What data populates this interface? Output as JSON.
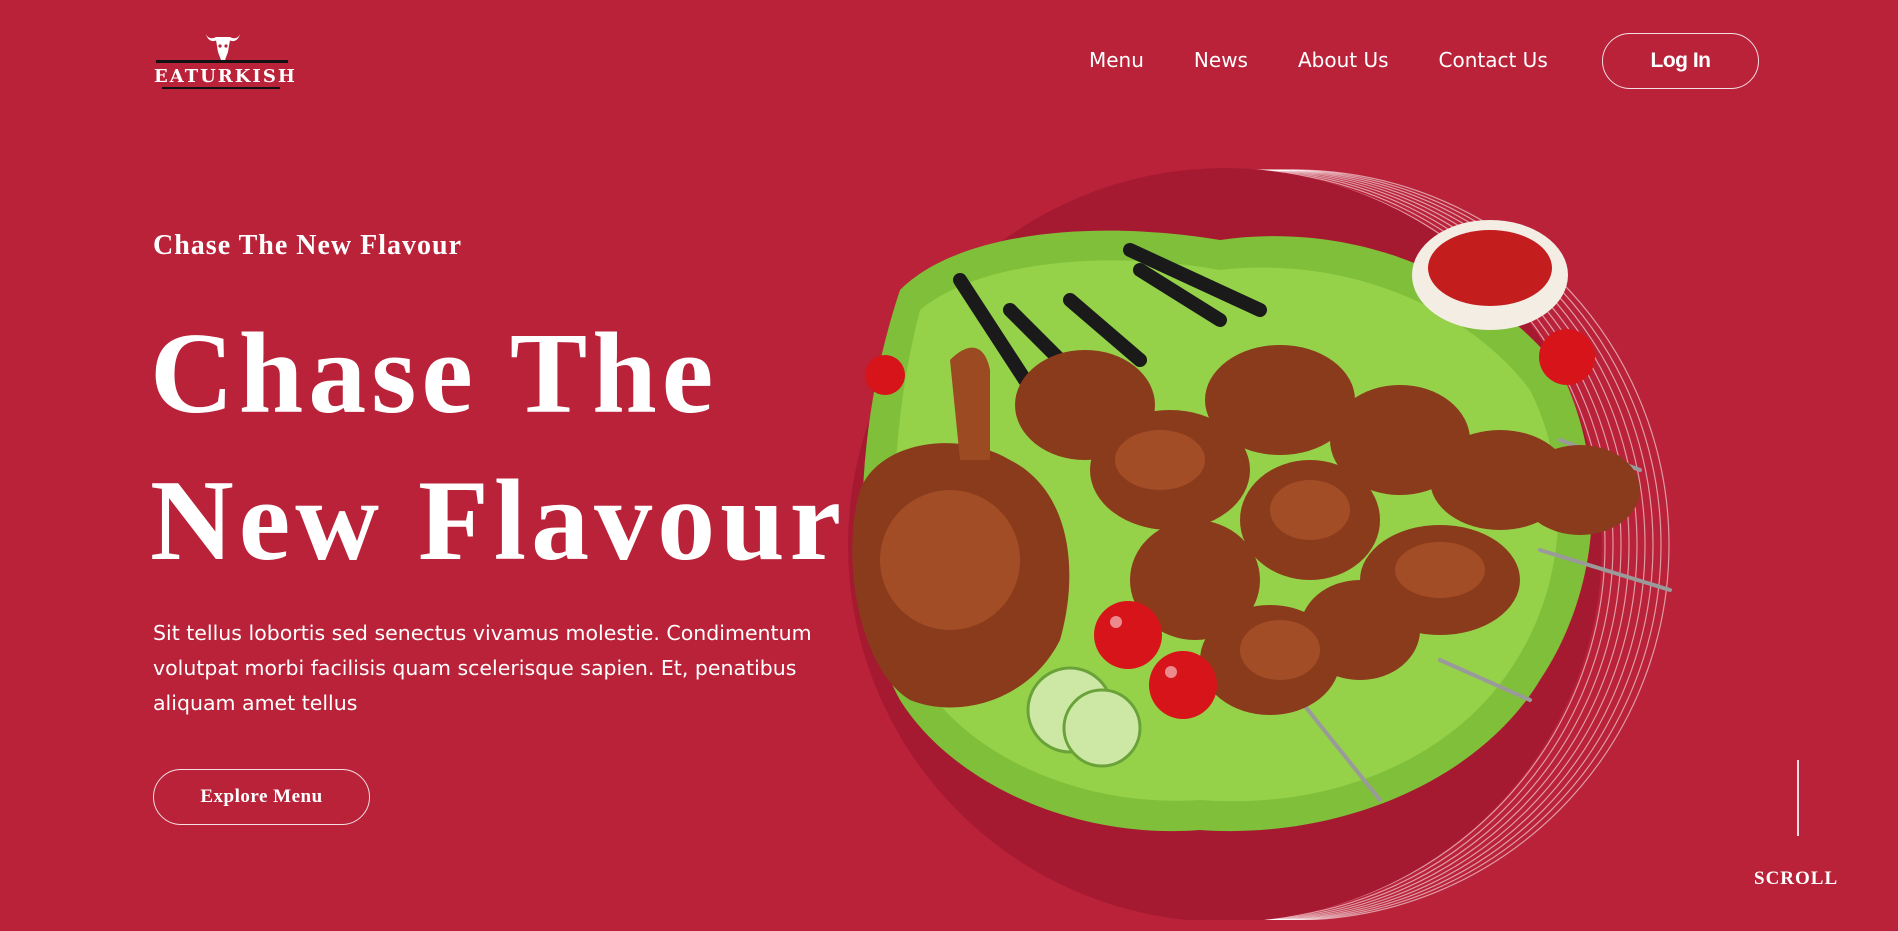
{
  "brand": {
    "name": "EATURKISH",
    "logo_icon": "bull-skull-icon"
  },
  "nav": {
    "items": [
      "Menu",
      "News",
      "About Us",
      "Contact Us"
    ],
    "login_label": "Log In"
  },
  "hero": {
    "eyebrow": "Chase The New Flavour",
    "title_line1": "Chase The",
    "title_line2": "New Flavour",
    "body": "Sit tellus lobortis sed senectus vivamus molestie. Condimentum volutpat morbi facilisis quam scelerisque sapien. Et, penatibus aliquam amet tellus",
    "cta_label": "Explore Menu",
    "image": "grilled-kebab-platter"
  },
  "scroll": {
    "label": "SCROLL"
  },
  "colors": {
    "background": "#b92239",
    "plate": "#a61a31",
    "text": "#ffffff"
  }
}
